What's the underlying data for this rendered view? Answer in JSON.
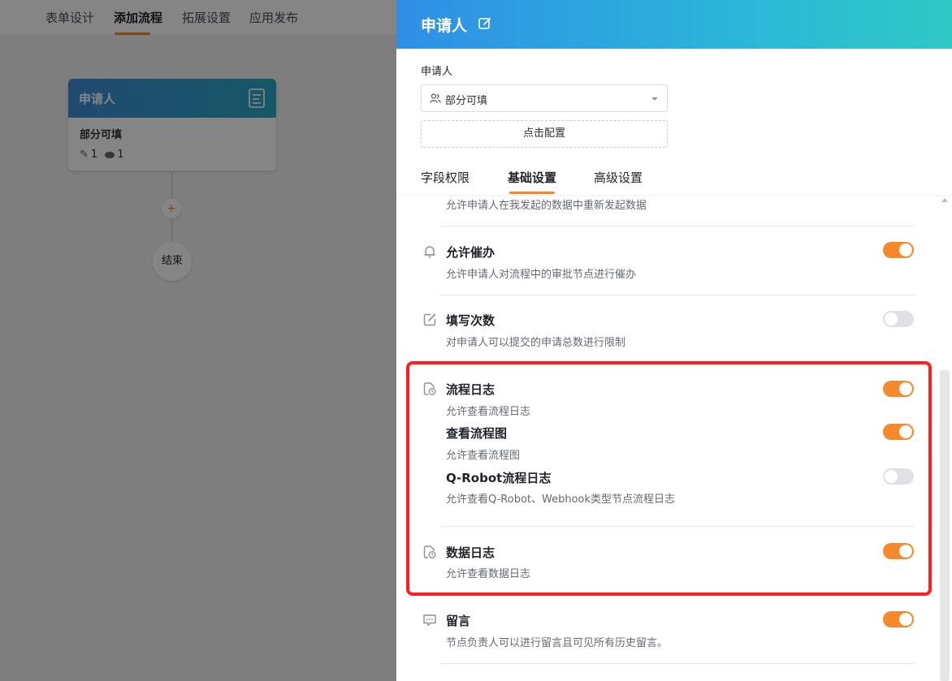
{
  "top_nav": {
    "tabs": [
      "表单设计",
      "添加流程",
      "拓展设置",
      "应用发布"
    ],
    "active_tab": "添加流程"
  },
  "flow": {
    "start_node": {
      "title": "申请人",
      "subtitle": "部分可填",
      "edit_count": "1",
      "view_count": "1"
    },
    "end_node": {
      "label": "结束"
    },
    "add_symbol": "+"
  },
  "drawer": {
    "title": "申请人",
    "field_label": "申请人",
    "select_value": "部分可填",
    "config_button": "点击配置",
    "tabs": [
      "字段权限",
      "基础设置",
      "高级设置"
    ],
    "active_tab": "基础设置",
    "settings": [
      {
        "title": "",
        "desc": "允许申请人在我发起的数据中重新发起数据",
        "enabled": null
      },
      {
        "icon": "bell-icon",
        "title": "允许催办",
        "desc": "允许申请人对流程中的审批节点进行催办",
        "enabled": true
      },
      {
        "icon": "edit-icon",
        "title": "填写次数",
        "desc": "对申请人可以提交的申请总数进行限制",
        "enabled": false
      },
      {
        "icon": "log-clock-icon",
        "title": "流程日志",
        "desc": "允许查看流程日志",
        "enabled": true
      },
      {
        "title": "查看流程图",
        "desc": "允许查看流程图",
        "enabled": true
      },
      {
        "title": "Q-Robot流程日志",
        "desc": "允许查看Q-Robot、Webhook类型节点流程日志",
        "enabled": false
      },
      {
        "icon": "log-clock-icon",
        "title": "数据日志",
        "desc": "允许查看数据日志",
        "enabled": true
      },
      {
        "icon": "comment-icon",
        "title": "留言",
        "desc": "节点负责人可以进行留言且可见所有历史留言。",
        "enabled": true
      }
    ]
  },
  "colors": {
    "accent": "#f5892b",
    "highlight": "#ff1f1f",
    "header_gradient_start": "#2f8fe6",
    "header_gradient_end": "#2fc9c6"
  }
}
